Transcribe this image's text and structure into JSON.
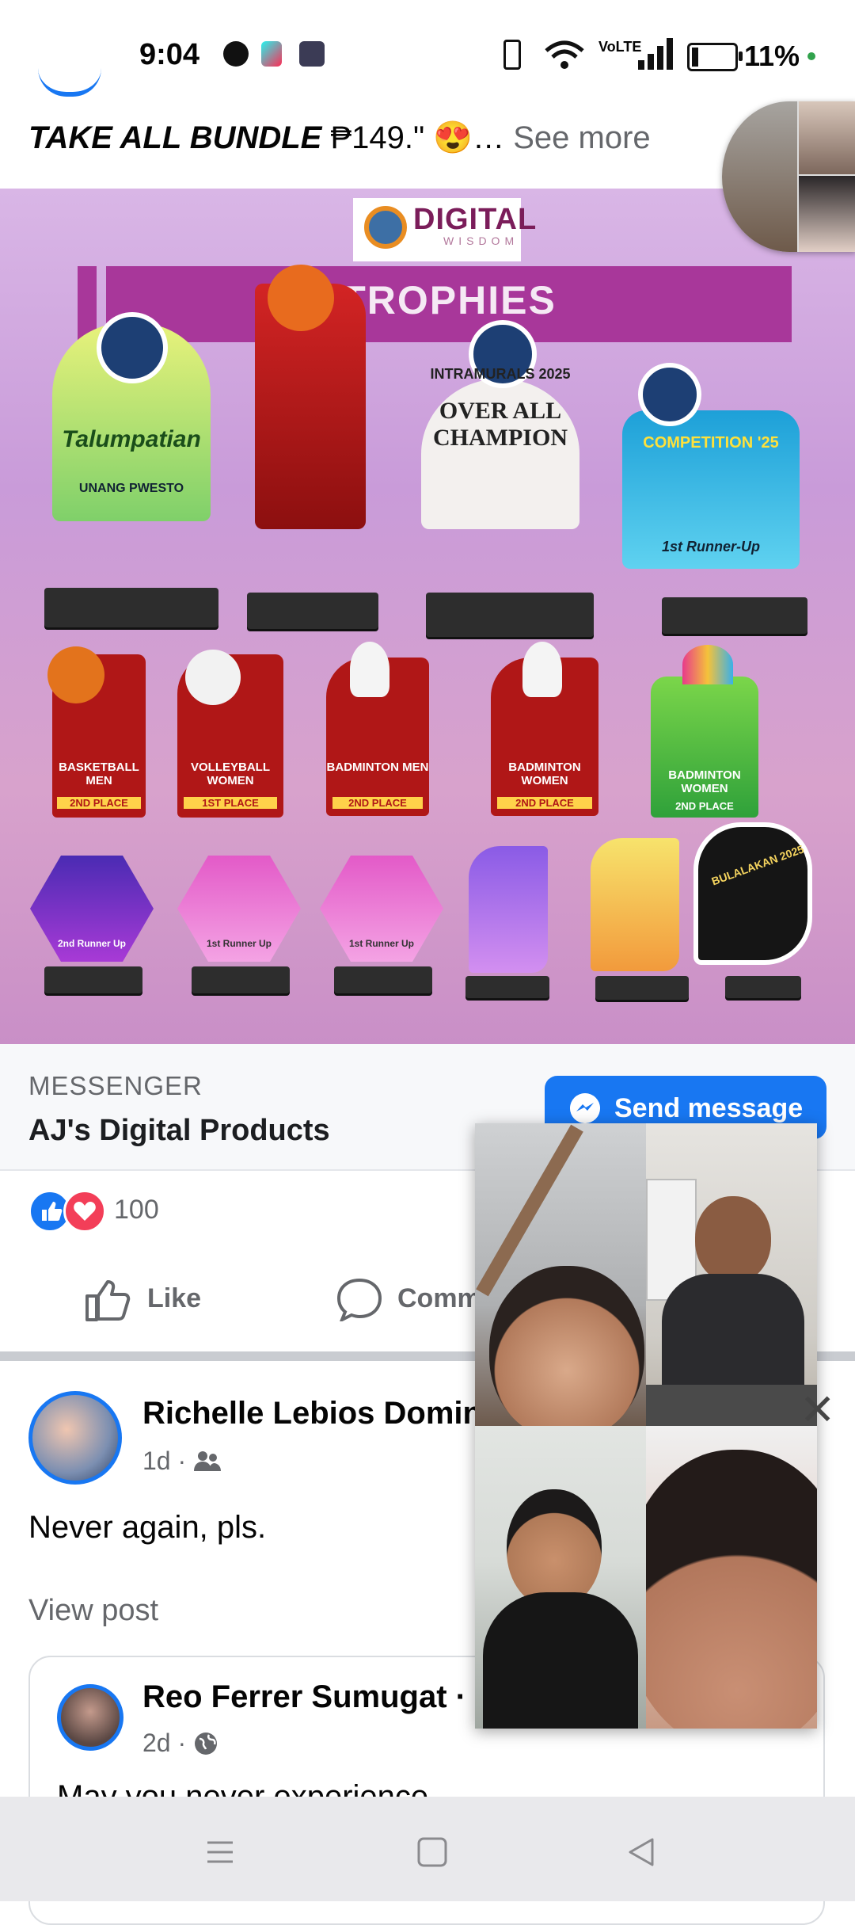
{
  "status_bar": {
    "time": "9:04",
    "battery_percent": "11%",
    "network": "VoLTE",
    "notification_icons": [
      "messenger-icon",
      "tiktok-icon",
      "app-icon"
    ]
  },
  "post": {
    "caption_bold": "TAKE ALL BUNDLE",
    "caption_rest": " ₱149.\" 😍…",
    "see_more": "See more",
    "image": {
      "brand": "DIGITAL",
      "brand_sub": "WISDOM",
      "banner": "TROPHIES",
      "trophy_labels": {
        "t1": "Talumpatian",
        "t1_sub": "UNANG PWESTO",
        "t3_top": "INTRAMURALS 2025",
        "t3_main": "OVER ALL CHAMPION",
        "t4": "COMPETITION '25",
        "t4_sub": "1st Runner-Up",
        "t5": "BASKETBALL MEN",
        "t5_place": "2ND PLACE",
        "t6": "VOLLEYBALL WOMEN",
        "t6_place": "1ST PLACE",
        "t7": "BADMINTON MEN",
        "t7_place": "2ND PLACE",
        "t8": "BADMINTON WOMEN",
        "t8_place": "2ND PLACE",
        "t9": "BADMINTON WOMEN",
        "t9_place": "2ND PLACE",
        "t10": "2nd Runner Up",
        "t11": "1st Runner Up",
        "t12": "1st Runner Up",
        "t15": "BULALAKAN 2025"
      }
    },
    "messenger": {
      "kicker": "MESSENGER",
      "page_name": "AJ's Digital Products",
      "button": "Send message"
    },
    "reactions": {
      "count": "100",
      "types": [
        "like",
        "love"
      ]
    },
    "actions": {
      "like": "Like",
      "comment": "Comm"
    }
  },
  "next_post": {
    "author": "Richelle Lebios Domin",
    "time": "1d",
    "audience_icon": "friends-icon",
    "text": "Never again, pls.",
    "view_post": "View post",
    "shared": {
      "author": "Reo Ferrer Sumugat",
      "dot": "·",
      "time": "2d",
      "audience_icon": "globe-icon",
      "partial_text": "May you never experience"
    }
  },
  "video_call": {
    "tiles": 4,
    "close": "✕"
  },
  "colors": {
    "facebook_blue": "#1877f2",
    "love_red": "#f33e58",
    "secondary_text": "#65676b",
    "banner_purple": "#a8379a"
  }
}
